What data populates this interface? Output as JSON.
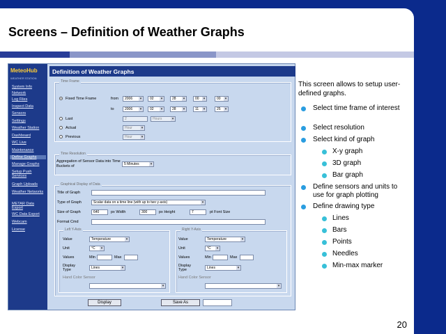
{
  "slide": {
    "title": "Screens – Definition of Weather Graphs",
    "number": "20",
    "intro": "This screen allows to setup user-defined graphs.",
    "bullets": [
      {
        "text": "Select time frame of interest",
        "children": []
      },
      {
        "text": "Select resolution",
        "children": []
      },
      {
        "text": "Select kind of graph",
        "children": [
          "X-y graph",
          "3D graph",
          "Bar graph"
        ]
      },
      {
        "text": "Define sensors and units to use for graph plotting",
        "children": []
      },
      {
        "text": "Define drawing type",
        "children": [
          "Lines",
          "Bars",
          "Points",
          "Needles",
          "Min-max marker"
        ]
      }
    ]
  },
  "app": {
    "logo": "MeteoHub",
    "logo_sub": "WEATHER STATION",
    "title": "Definition of Weather Graphs",
    "nav": [
      "System Info",
      "Network",
      "Log Files",
      "Inspect Data",
      "Sensors",
      "Settings",
      "Weather Station",
      "Dashboard",
      "WC Live",
      "Maintenance",
      "Define Graphs",
      "Manage Graphs",
      "Setup Push Services",
      "Graph Uploads",
      "Weather Networks",
      "METAR Data Export",
      "WC Data Export",
      "Webcam",
      "License"
    ],
    "nav_active_index": 10,
    "time_frame": {
      "legend": "Time Frame",
      "fixed_label": "Fixed Time Frame",
      "from_label": "from",
      "to_label": "to",
      "from": {
        "year": "2006",
        "month": "02",
        "day": "28",
        "hour": "00",
        "minute": "00"
      },
      "to": {
        "year": "2006",
        "month": "02",
        "day": "28",
        "hour": "11",
        "minute": "25"
      },
      "last_label": "Last",
      "last_value": "2",
      "last_unit": "Hours",
      "actual_label": "Actual",
      "actual_unit": "Hour",
      "previous_label": "Previous",
      "previous_unit": "Hour"
    },
    "time_resolution": {
      "legend": "Time Resolution",
      "label": "Aggregation of Sensor Data into Time Buckets of",
      "value": "5 Minutes"
    },
    "graphical_display": {
      "legend": "Graphical Display of Data",
      "title_label": "Title of Graph",
      "type_label": "Type of Graph",
      "type_value": "Scalar data on a time line (with up to two y-axis)",
      "size_label": "Size of Graph",
      "width_value": "640",
      "width_label": "px Width",
      "height_value": "300",
      "height_label": "px Height",
      "font_value": "7",
      "font_label": "pt Font Size",
      "format_label": "Format Cmd",
      "axes": [
        {
          "legend": "Left Y-Axis",
          "value_label": "Value",
          "value": "Temperature",
          "unit_label": "Unit",
          "unit": "°C",
          "values_label": "Values",
          "min_label": "Min",
          "max_label": "Max",
          "display_label": "Display Type",
          "display": "Lines",
          "color_label": "Hand Color Sensor"
        },
        {
          "legend": "Right Y-Axis",
          "value_label": "Value",
          "value": "Temperature",
          "unit_label": "Unit",
          "unit": "°C",
          "values_label": "Values",
          "min_label": "Min",
          "max_label": "Max",
          "display_label": "Display Type",
          "display": "Lines",
          "color_label": "Hand Color Sensor"
        }
      ]
    },
    "buttons": {
      "display": "Display",
      "save_as": "Save As"
    }
  }
}
